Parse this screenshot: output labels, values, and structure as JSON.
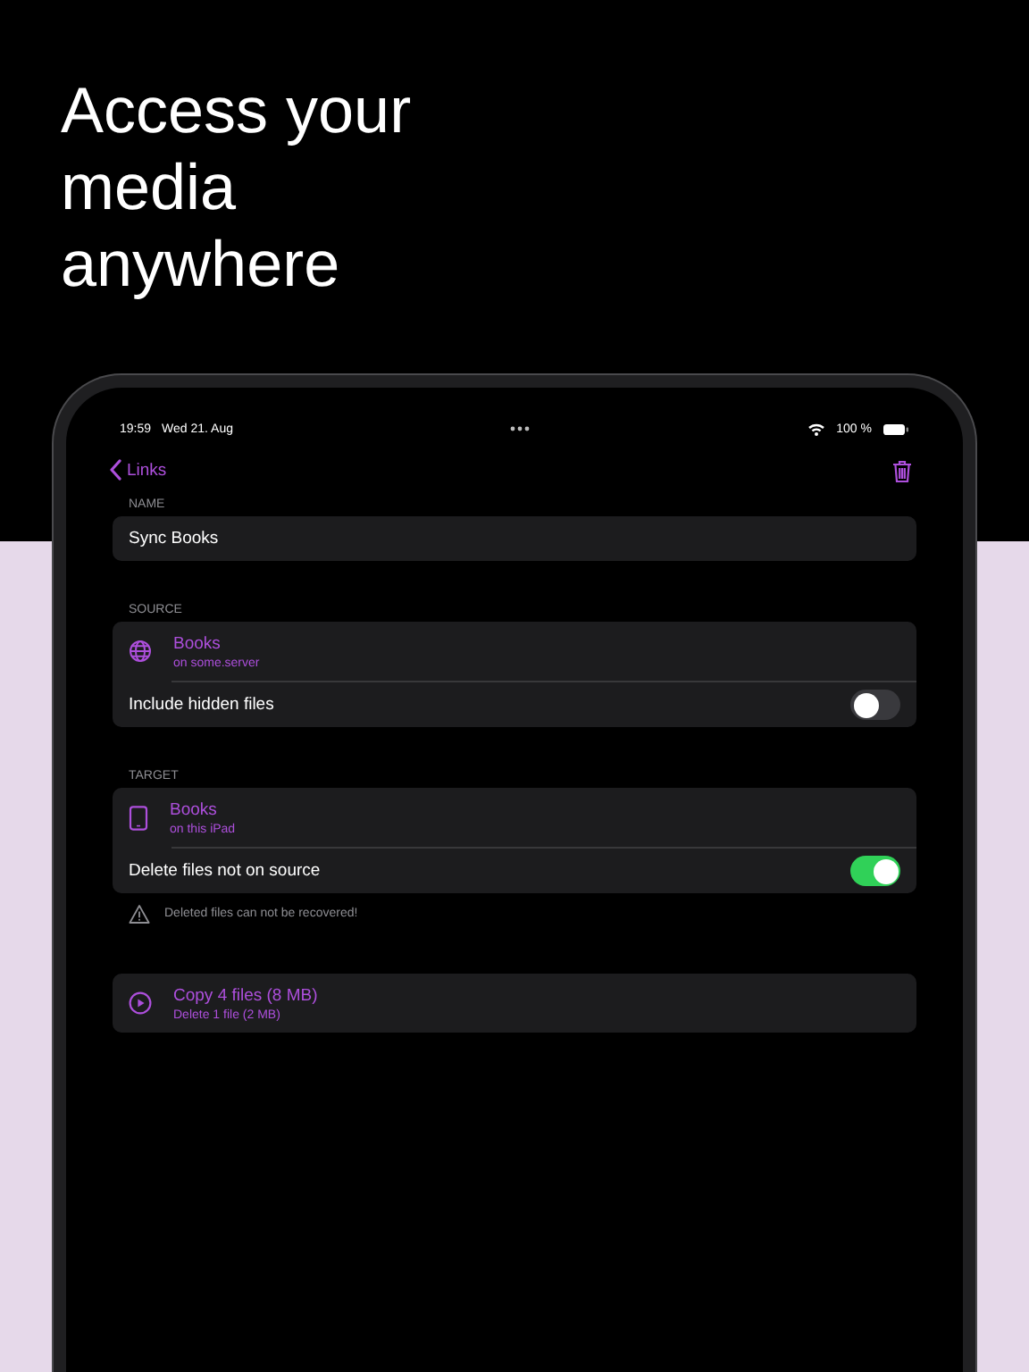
{
  "headline": "Access your\nmedia\nanywhere",
  "status_bar": {
    "time": "19:59",
    "date": "Wed 21. Aug",
    "battery": "100 %"
  },
  "nav": {
    "back": "Links"
  },
  "sections": [
    {
      "header": "NAME",
      "rows": [
        {
          "kind": "field",
          "value": "Sync Books"
        }
      ]
    },
    {
      "header": "SOURCE",
      "rows": [
        {
          "kind": "remote",
          "title": "Books",
          "subtitle": "on some.server"
        },
        {
          "kind": "toggle",
          "label": "Include hidden files",
          "on": false
        }
      ]
    },
    {
      "header": "TARGET",
      "rows": [
        {
          "kind": "local",
          "title": "Books",
          "subtitle": "on this iPad"
        },
        {
          "kind": "toggle",
          "label": "Delete files not on source",
          "on": true
        }
      ],
      "footer": "Deleted files can not be recovered!"
    },
    {
      "rows": [
        {
          "kind": "action",
          "title": "Copy 4 files (8 MB)",
          "subtitle": "Delete 1 file (2 MB)"
        }
      ]
    }
  ]
}
